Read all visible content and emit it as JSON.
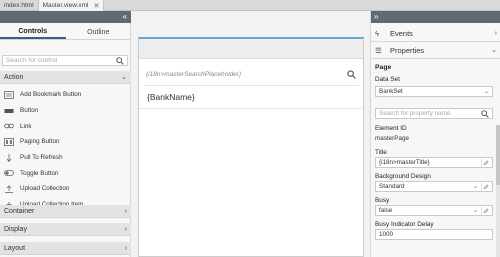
{
  "tabs": [
    {
      "label": "index.html"
    },
    {
      "label": "Master.view.xml"
    }
  ],
  "left_panel": {
    "palette_tabs": [
      {
        "label": "Controls",
        "active": true
      },
      {
        "label": "Outline",
        "active": false
      }
    ],
    "search_placeholder": "Search for control",
    "groups": {
      "action": "Action",
      "container": "Container",
      "display": "Display",
      "layout": "Layout"
    },
    "controls": [
      {
        "label": "Add Bookmark Button",
        "icon": "bookmark-button-icon"
      },
      {
        "label": "Button",
        "icon": "button-icon"
      },
      {
        "label": "Link",
        "icon": "link-icon"
      },
      {
        "label": "Paging Button",
        "icon": "paging-button-icon"
      },
      {
        "label": "Pull To Refresh",
        "icon": "pull-to-refresh-icon"
      },
      {
        "label": "Toggle Button",
        "icon": "toggle-button-icon"
      },
      {
        "label": "Upload Collection",
        "icon": "upload-collection-icon"
      },
      {
        "label": "Upload Collection Item",
        "icon": "upload-collection-item-icon"
      }
    ]
  },
  "canvas": {
    "search_placeholder": "{i18n>masterSearchPlaceholder}",
    "list_item": "{BankName}"
  },
  "right_panel": {
    "sections": {
      "events": "Events",
      "properties": "Properties"
    },
    "properties": {
      "page_heading": "Page",
      "data_set_label": "Data Set",
      "data_set_value": "BankSet",
      "search_placeholder": "Search for property name",
      "element_id_label": "Element ID",
      "element_id_value": "masterPage",
      "title_label": "Title",
      "title_value": "{i18n>masterTitle}",
      "background_label": "Background Design",
      "background_value": "Standard",
      "busy_label": "Busy",
      "busy_value": "false",
      "busy_delay_label": "Busy Indicator Delay",
      "busy_delay_value": "1000"
    }
  },
  "colors": {
    "collapse_bar": "#5f6a72",
    "active_tab_underline": "#3f5e85",
    "device_accent": "#6aa6cf"
  }
}
